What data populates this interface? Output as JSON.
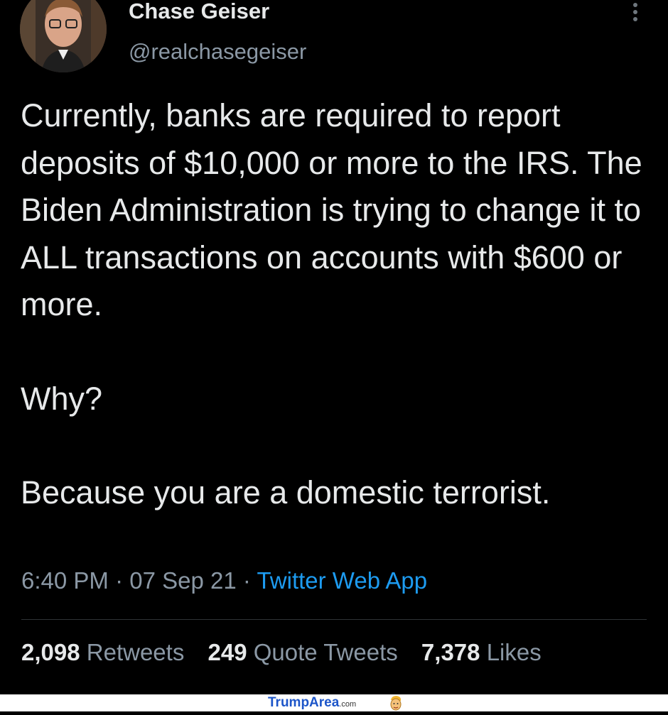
{
  "author": {
    "display_name": "Chase Geiser",
    "handle": "@realchasegeiser"
  },
  "tweet": {
    "paragraphs": [
      "Currently, banks are required to report deposits of $10,000 or more to the IRS. The Biden Administration is trying to change it to ALL transactions on accounts with $600 or more.",
      "Why?",
      "Because you are a domestic terrorist."
    ],
    "time": "6:40 PM",
    "date": "07 Sep 21",
    "source": "Twitter Web App",
    "separator": " · "
  },
  "stats": [
    {
      "count": "2,098",
      "label": "Retweets"
    },
    {
      "count": "249",
      "label": "Quote Tweets"
    },
    {
      "count": "7,378",
      "label": "Likes"
    }
  ],
  "watermark": {
    "brand": "TrumpArea",
    "suffix": ".com"
  },
  "icons": {
    "more": "more-vertical-icon",
    "watermark_face": "cartoon-face-icon"
  },
  "colors": {
    "background": "#000000",
    "text": "#e7e9ea",
    "secondary": "#8b98a5",
    "link": "#1d9bf0",
    "watermark_brand": "#1d56c9"
  }
}
